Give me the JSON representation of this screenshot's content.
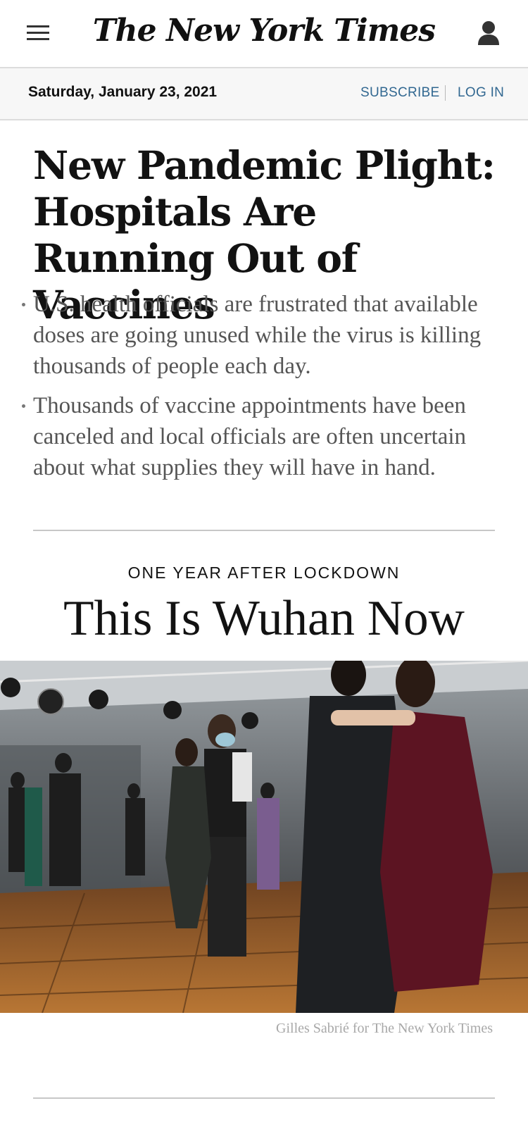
{
  "header": {
    "logo_text": "The New York Times",
    "menu_icon": "hamburger-menu-icon",
    "account_icon": "user-account-icon"
  },
  "datebar": {
    "date": "Saturday, January 23, 2021",
    "subscribe_label": "SUBSCRIBE",
    "login_label": "LOG IN"
  },
  "lead_story": {
    "headline": "New Pandemic Plight: Hospitals Are Running Out of Vaccines",
    "summary": [
      "U.S. health officials are frustrated that available doses are going unused while the virus is killing thousands of people each day.",
      "Thousands of vaccine appointments have been canceled and local officials are often uncertain about what supplies they will have in hand."
    ]
  },
  "promo": {
    "kicker": "ONE YEAR AFTER LOCKDOWN",
    "title": "This Is Wuhan Now",
    "photo_credit": "Gilles Sabrié for The New York Times"
  },
  "colors": {
    "link_blue": "#326891",
    "text_dark": "#121212",
    "summary_gray": "#555555"
  }
}
